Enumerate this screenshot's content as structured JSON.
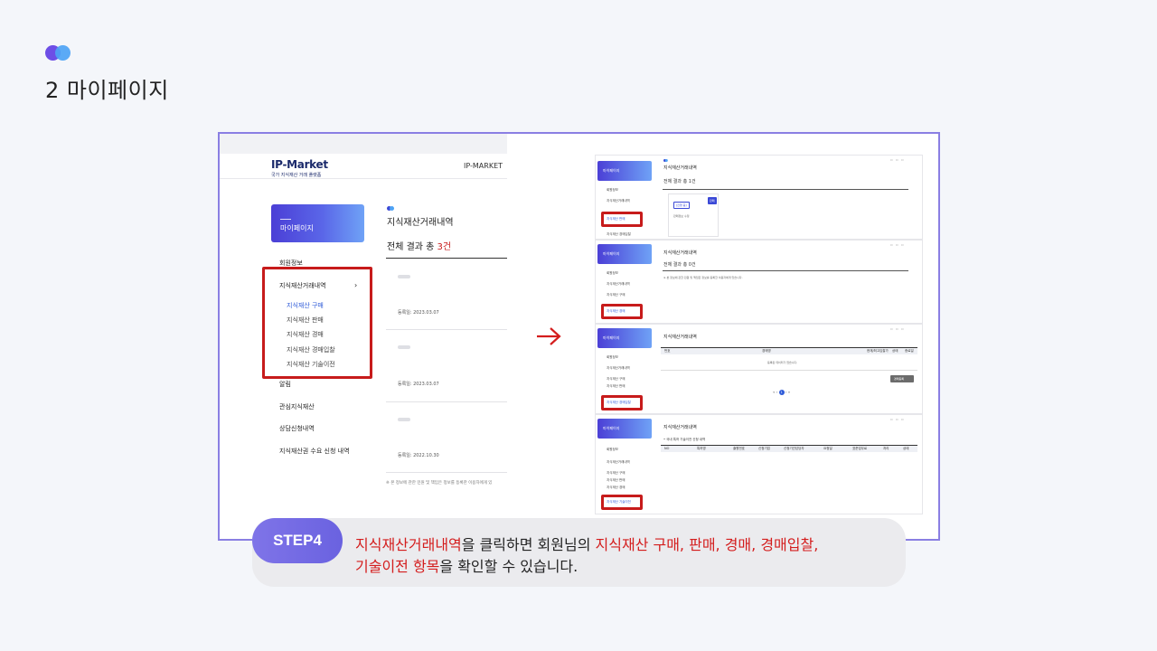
{
  "section": {
    "title": "2 마이페이지"
  },
  "left_screenshot": {
    "brand_name": "IP-Market",
    "brand_sub": "국가 지식재산 거래 플랫폼",
    "top_nav": "IP-MARKET",
    "mypage_label": "마이페이지",
    "sidebar": {
      "member_info": "회원정보",
      "trade_history": "지식재산거래내역",
      "chevron": "›",
      "sub_items": [
        "지식재산 구매",
        "지식재산 판매",
        "지식재산 경매",
        "지식재산 경매입찰",
        "지식재산 기술이전"
      ],
      "more_items": [
        "알림",
        "관심지식재산",
        "상담신청내역",
        "지식재산권 수요 신청 내역"
      ]
    },
    "content": {
      "title": "지식재산거래내역",
      "count_prefix": "전체 결과 총 ",
      "count_value": "3건",
      "reg_dates": [
        "등록일: 2023.03.07",
        "등록일: 2023.03.07",
        "등록일: 2022.10.30"
      ],
      "footnote": "※ 본 정보에 관한 민원 및 책임은 정보를 등록한 이용자에게 있"
    }
  },
  "right_screenshots": [
    {
      "mypage_label": "마이페이지",
      "title": "지식재산거래내역",
      "count": "전체 결과 총 1건",
      "sidebar": [
        "회원정보",
        "지식재산거래내역"
      ],
      "highlighted": "지식재산 판매",
      "extra": "지식재산 경매입찰",
      "tag": "[진행 중]",
      "btn": "판매",
      "desc": "판매정보 수정"
    },
    {
      "mypage_label": "마이페이지",
      "title": "지식재산거래내역",
      "count": "전체 결과 총 0건",
      "sidebar": [
        "회원정보",
        "지식재산거래내역",
        "지식재산 구매"
      ],
      "highlighted": "지식재산 경매",
      "note": "※ 본 정보에 관한 민원 및 책임은 정보를 등록한 이용자에게 있습니다."
    },
    {
      "mypage_label": "마이페이지",
      "title": "지식재산거래내역",
      "sidebar": [
        "회원정보",
        "지식재산거래내역",
        "지식재산 구매",
        "지식재산 판매"
      ],
      "highlighted": "지식재산 경매입찰",
      "table_headers": [
        "번호",
        "경매명",
        "현재/최고입찰가",
        "상태",
        "종료일"
      ],
      "empty_message": "등록된 데이터가 없습니다.",
      "pager": [
        "«",
        "‹",
        "1",
        "›",
        "»"
      ],
      "btn": "경매등록"
    },
    {
      "mypage_label": "마이페이지",
      "title": "지식재산거래내역",
      "sidebar": [
        "회원정보",
        "지식재산거래내역",
        "지식재산 구매",
        "지식재산 판매",
        "지식재산 경매"
      ],
      "highlighted": "지식재산 기술이전",
      "subtitle": "• 국내 특허 기술이전 신청 내역",
      "table_headers": [
        "NO",
        "특허명",
        "출원번호",
        "신청기업",
        "신청기관담당자",
        "요청일",
        "표준업무료",
        "처리",
        "상태"
      ]
    }
  ],
  "callout": {
    "step": "STEP4",
    "line1": [
      {
        "text": "지식재산거래내역",
        "red": true
      },
      {
        "text": "을 클릭하면 회원님의 ",
        "red": false
      },
      {
        "text": "지식재산 구매, 판매, 경매, 경매입찰,",
        "red": true
      }
    ],
    "line2": [
      {
        "text": "기술이전 항목",
        "red": true
      },
      {
        "text": "을 확인할 수 있습니다.",
        "red": false
      }
    ]
  },
  "colors": {
    "accent": "#6d4ee6",
    "accent2": "#4da3f5",
    "highlight_red": "#c71b1b",
    "frame": "#8a7fe3"
  }
}
